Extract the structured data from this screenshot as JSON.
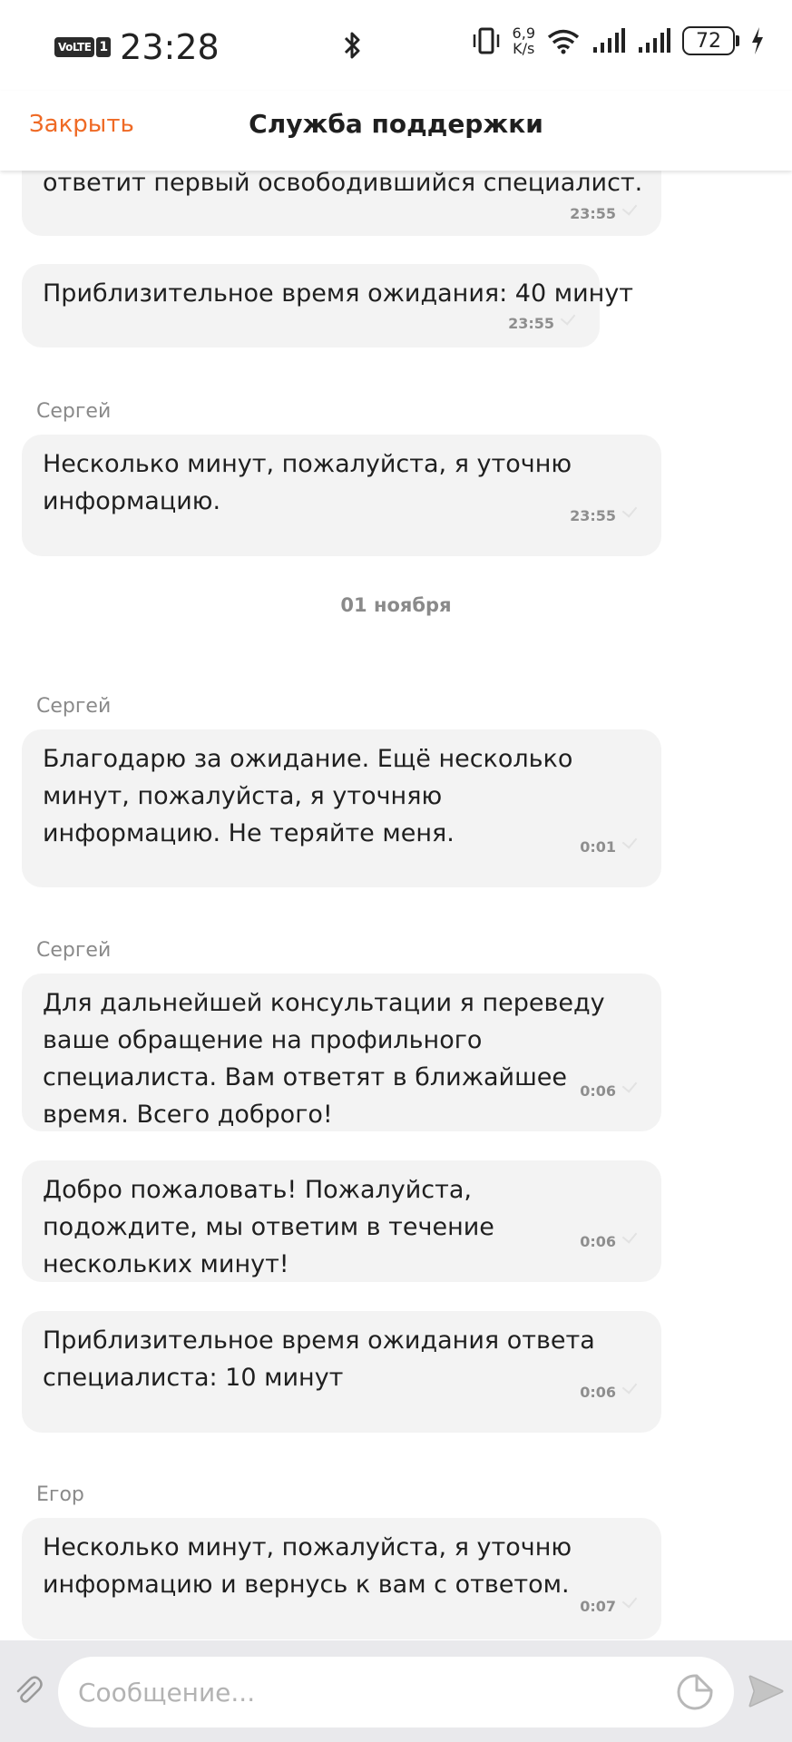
{
  "status_bar": {
    "network_badge": "VoLTE",
    "sim_slot": "1",
    "time": "23:28",
    "speed_value": "6,9",
    "speed_unit": "K/s",
    "battery": "72"
  },
  "header": {
    "close_label": "Закрыть",
    "title": "Служба поддержки"
  },
  "messages": [
    {
      "text": "ответит первый освободившийся специалист.",
      "time": "23:55"
    },
    {
      "text": "Приблизительное время ожидания: 40 минут",
      "time": "23:55"
    },
    {
      "sender": "Сергей",
      "text": "Несколько минут, пожалуйста, я уточню информацию.",
      "time": "23:55"
    },
    {
      "sender": "Сергей",
      "text": "Благодарю за ожидание. Ещё несколько минут, пожалуйста, я уточняю информацию. Не теряйте меня.",
      "time": "0:01"
    },
    {
      "sender": "Сергей",
      "text": "Для дальнейшей консультации я переведу ваше обращение на профильного специалиста. Вам ответят в ближайшее время. Всего доброго!",
      "time": "0:06"
    },
    {
      "text": "Добро пожаловать! Пожалуйста, подождите, мы ответим в течение нескольких минут!",
      "time": "0:06"
    },
    {
      "text": "Приблизительное время ожидания ответа специалиста: 10 минут",
      "time": "0:06"
    },
    {
      "sender": "Егор",
      "text": "Несколько минут, пожалуйста, я уточню информацию и вернусь к вам с ответом.",
      "time": "0:07"
    }
  ],
  "date_separator": "01 ноября",
  "input": {
    "placeholder": "Сообщение..."
  },
  "icons": {
    "attach": "paperclip-icon",
    "sticker": "sticker-icon",
    "send": "send-icon"
  },
  "colors": {
    "accent": "#ef6a25",
    "bubble": "#f3f3f3",
    "input_bar": "#e9e9ec"
  }
}
